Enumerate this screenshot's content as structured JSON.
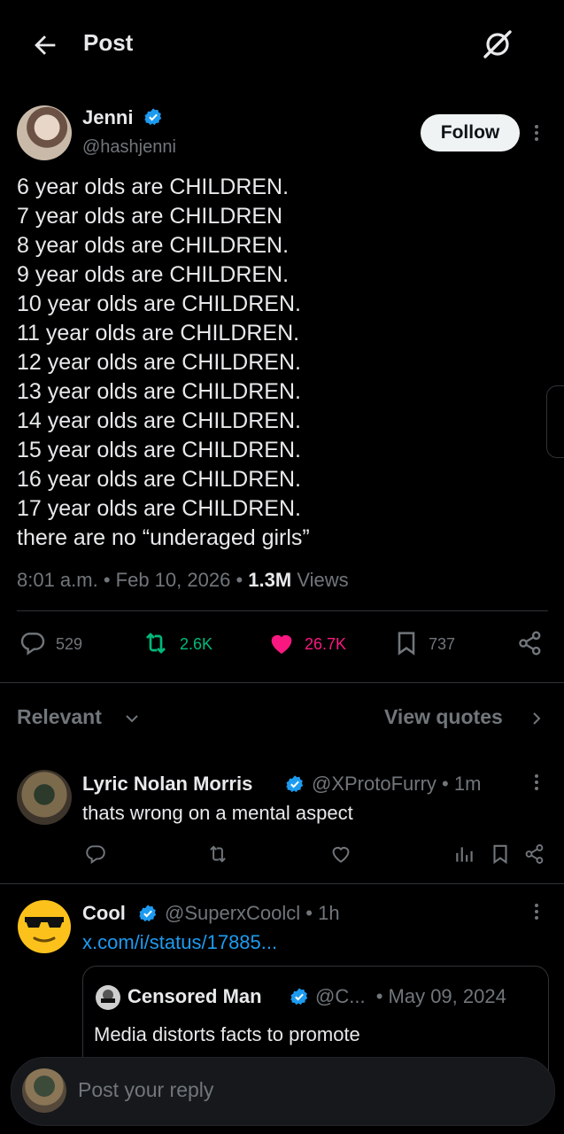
{
  "header": {
    "title": "Post"
  },
  "post": {
    "author": {
      "name": "Jenni",
      "handle": "@hashjenni"
    },
    "follow_label": "Follow",
    "lines": [
      "6 year olds are CHILDREN.",
      "7 year olds are CHILDREN",
      "8 year olds are CHILDREN.",
      "9 year olds are CHILDREN.",
      "10 year olds are CHILDREN.",
      "11 year olds are CHILDREN.",
      "12 year olds are CHILDREN.",
      "13 year olds are CHILDREN.",
      "14 year olds are CHILDREN.",
      "15 year olds are CHILDREN.",
      "16 year olds are CHILDREN.",
      "17 year olds are CHILDREN.",
      "there are no “underaged girls”"
    ],
    "time": "8:01 a.m.",
    "date": "Feb 10, 2026",
    "views_count": "1.3M",
    "views_label": "Views",
    "actions": {
      "replies": "529",
      "reposts": "2.6K",
      "likes": "26.7K",
      "bookmarks": "737"
    }
  },
  "sort": {
    "label": "Relevant",
    "quotes_label": "View quotes"
  },
  "replies": [
    {
      "name": "Lyric Nolan Morris",
      "handle": "@XProtoFurry",
      "time": "1m",
      "text": "thats wrong on a mental aspect"
    },
    {
      "name": "Cool",
      "handle": "@SuperxCoolcl",
      "time": "1h",
      "link": "x.com/i/status/17885...",
      "quote": {
        "name": "Censored Man",
        "handle": "@C...",
        "date": "May 09, 2024",
        "text": "Media distorts facts to promote"
      }
    }
  ],
  "composer": {
    "placeholder": "Post your reply"
  },
  "colors": {
    "accent": "#1d9bf0",
    "repost": "#00ba7c",
    "like": "#f91880",
    "muted": "#71767b"
  }
}
